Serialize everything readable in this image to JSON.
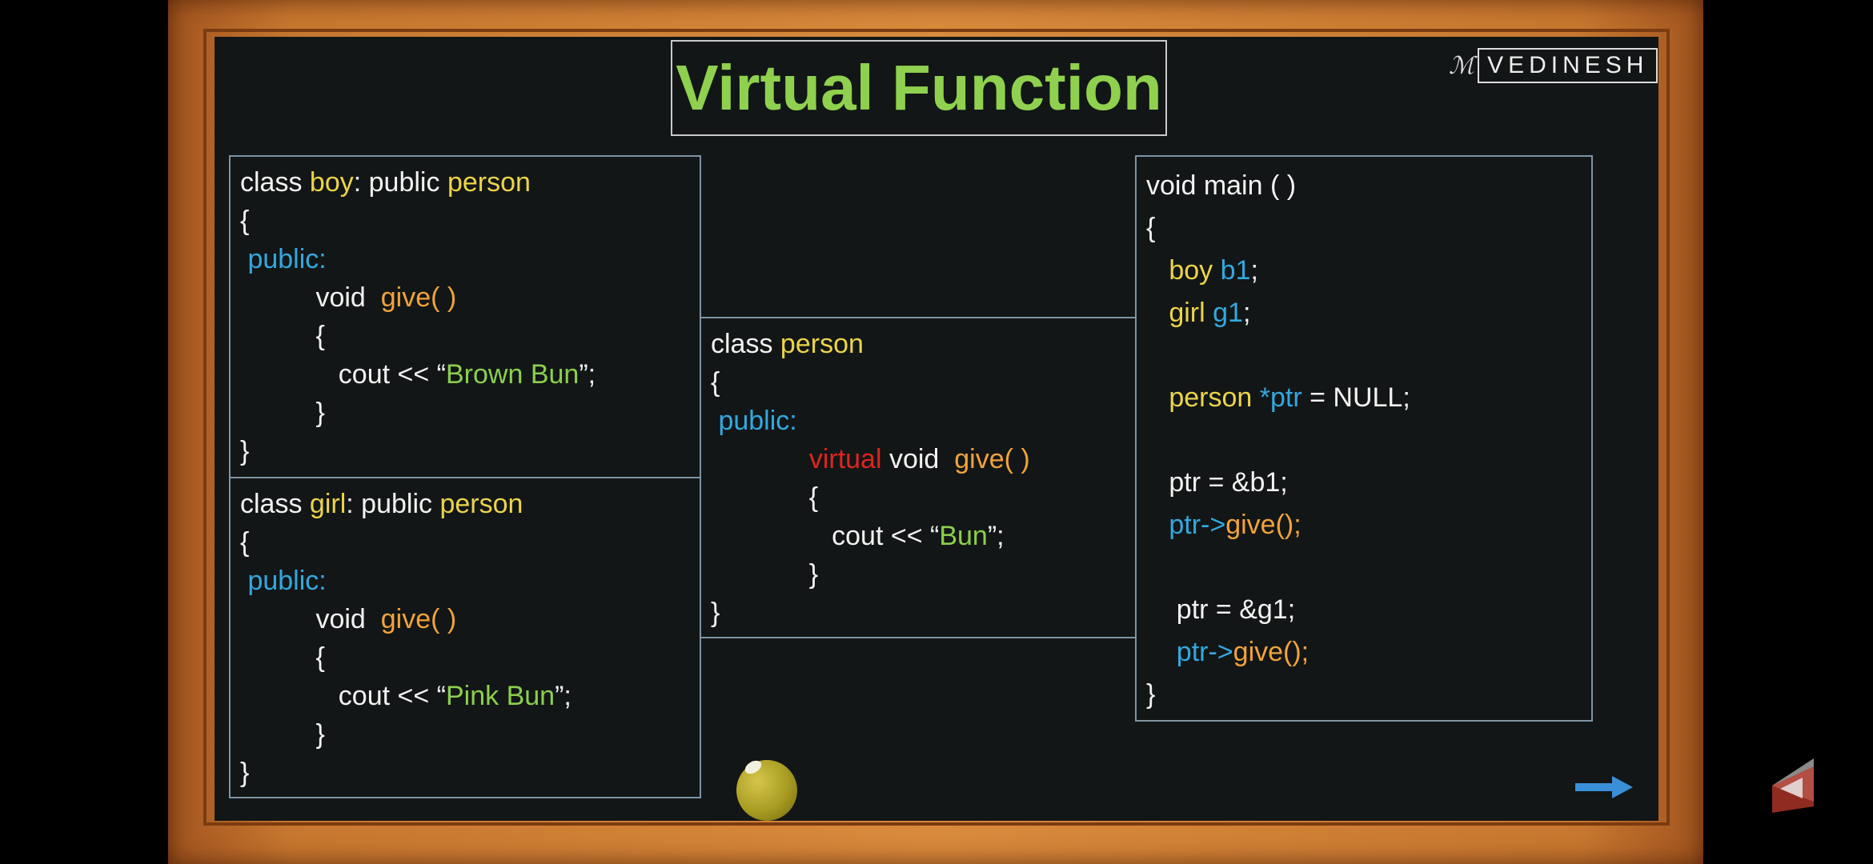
{
  "title": "Virtual Function",
  "logo": {
    "mark": "ℳ",
    "text": "VEDINESH"
  },
  "boy_class": [
    [
      {
        "t": "class ",
        "c": "w"
      },
      {
        "t": "boy",
        "c": "y"
      },
      {
        "t": ": public ",
        "c": "w"
      },
      {
        "t": "person",
        "c": "y"
      }
    ],
    [
      {
        "t": "{",
        "c": "w"
      }
    ],
    [
      {
        "t": " public:",
        "c": "b"
      }
    ],
    [
      {
        "t": "          void  ",
        "c": "w"
      },
      {
        "t": "give( )",
        "c": "o"
      }
    ],
    [
      {
        "t": "          {",
        "c": "w"
      }
    ],
    [
      {
        "t": "             cout << “",
        "c": "w"
      },
      {
        "t": "Brown Bun",
        "c": "g"
      },
      {
        "t": "”;",
        "c": "w"
      }
    ],
    [
      {
        "t": "          }",
        "c": "w"
      }
    ],
    [
      {
        "t": "}",
        "c": "w"
      }
    ]
  ],
  "girl_class": [
    [
      {
        "t": "class ",
        "c": "w"
      },
      {
        "t": "girl",
        "c": "y"
      },
      {
        "t": ": public ",
        "c": "w"
      },
      {
        "t": "person",
        "c": "y"
      }
    ],
    [
      {
        "t": "{",
        "c": "w"
      }
    ],
    [
      {
        "t": " public:",
        "c": "b"
      }
    ],
    [
      {
        "t": "          void  ",
        "c": "w"
      },
      {
        "t": "give( )",
        "c": "o"
      }
    ],
    [
      {
        "t": "          {",
        "c": "w"
      }
    ],
    [
      {
        "t": "             cout << “",
        "c": "w"
      },
      {
        "t": "Pink Bun",
        "c": "g"
      },
      {
        "t": "”;",
        "c": "w"
      }
    ],
    [
      {
        "t": "          }",
        "c": "w"
      }
    ],
    [
      {
        "t": "}",
        "c": "w"
      }
    ]
  ],
  "person_class": [
    [
      {
        "t": "class ",
        "c": "w"
      },
      {
        "t": "person",
        "c": "y"
      }
    ],
    [
      {
        "t": "{",
        "c": "w"
      }
    ],
    [
      {
        "t": " public:",
        "c": "b"
      }
    ],
    [
      {
        "t": "             ",
        "c": "w"
      },
      {
        "t": "virtual",
        "c": "r"
      },
      {
        "t": " void  ",
        "c": "w"
      },
      {
        "t": "give( )",
        "c": "o"
      }
    ],
    [
      {
        "t": "             {",
        "c": "w"
      }
    ],
    [
      {
        "t": "                cout << “",
        "c": "w"
      },
      {
        "t": "Bun",
        "c": "g"
      },
      {
        "t": "”;",
        "c": "w"
      }
    ],
    [
      {
        "t": "             }",
        "c": "w"
      }
    ],
    [
      {
        "t": "}",
        "c": "w"
      }
    ]
  ],
  "main_fn": [
    [
      {
        "t": "void main ( )",
        "c": "w"
      }
    ],
    [
      {
        "t": "{",
        "c": "w"
      }
    ],
    [
      {
        "t": "   ",
        "c": "w"
      },
      {
        "t": "boy ",
        "c": "y"
      },
      {
        "t": "b1",
        "c": "b"
      },
      {
        "t": ";",
        "c": "w"
      }
    ],
    [
      {
        "t": "   ",
        "c": "w"
      },
      {
        "t": "girl ",
        "c": "y"
      },
      {
        "t": "g1",
        "c": "b"
      },
      {
        "t": ";",
        "c": "w"
      }
    ],
    [
      {
        "t": "",
        "c": "w"
      }
    ],
    [
      {
        "t": "   ",
        "c": "w"
      },
      {
        "t": "person ",
        "c": "y"
      },
      {
        "t": "*ptr",
        "c": "b"
      },
      {
        "t": " = NULL;",
        "c": "w"
      }
    ],
    [
      {
        "t": "",
        "c": "w"
      }
    ],
    [
      {
        "t": "   ptr = &b1;",
        "c": "w"
      }
    ],
    [
      {
        "t": "   ",
        "c": "w"
      },
      {
        "t": "ptr->",
        "c": "b"
      },
      {
        "t": "give();",
        "c": "o"
      }
    ],
    [
      {
        "t": "",
        "c": "w"
      }
    ],
    [
      {
        "t": "    ptr = &g1;",
        "c": "w"
      }
    ],
    [
      {
        "t": "    ",
        "c": "w"
      },
      {
        "t": "ptr->",
        "c": "b"
      },
      {
        "t": "give();",
        "c": "o"
      }
    ],
    [
      {
        "t": "}",
        "c": "w"
      }
    ]
  ],
  "colors": {
    "keyword_yellow": "#ecd44a",
    "access_blue": "#33a8e0",
    "method_orange": "#f2a33a",
    "string_green": "#8ccf4d",
    "virtual_red": "#e0241f",
    "title_green": "#8fd14f",
    "arrow_blue": "#3a8fd9"
  },
  "icons": {
    "arrow": "right-arrow-icon",
    "pointer": "laser-pointer-ball",
    "corner": "player-logo-icon"
  }
}
